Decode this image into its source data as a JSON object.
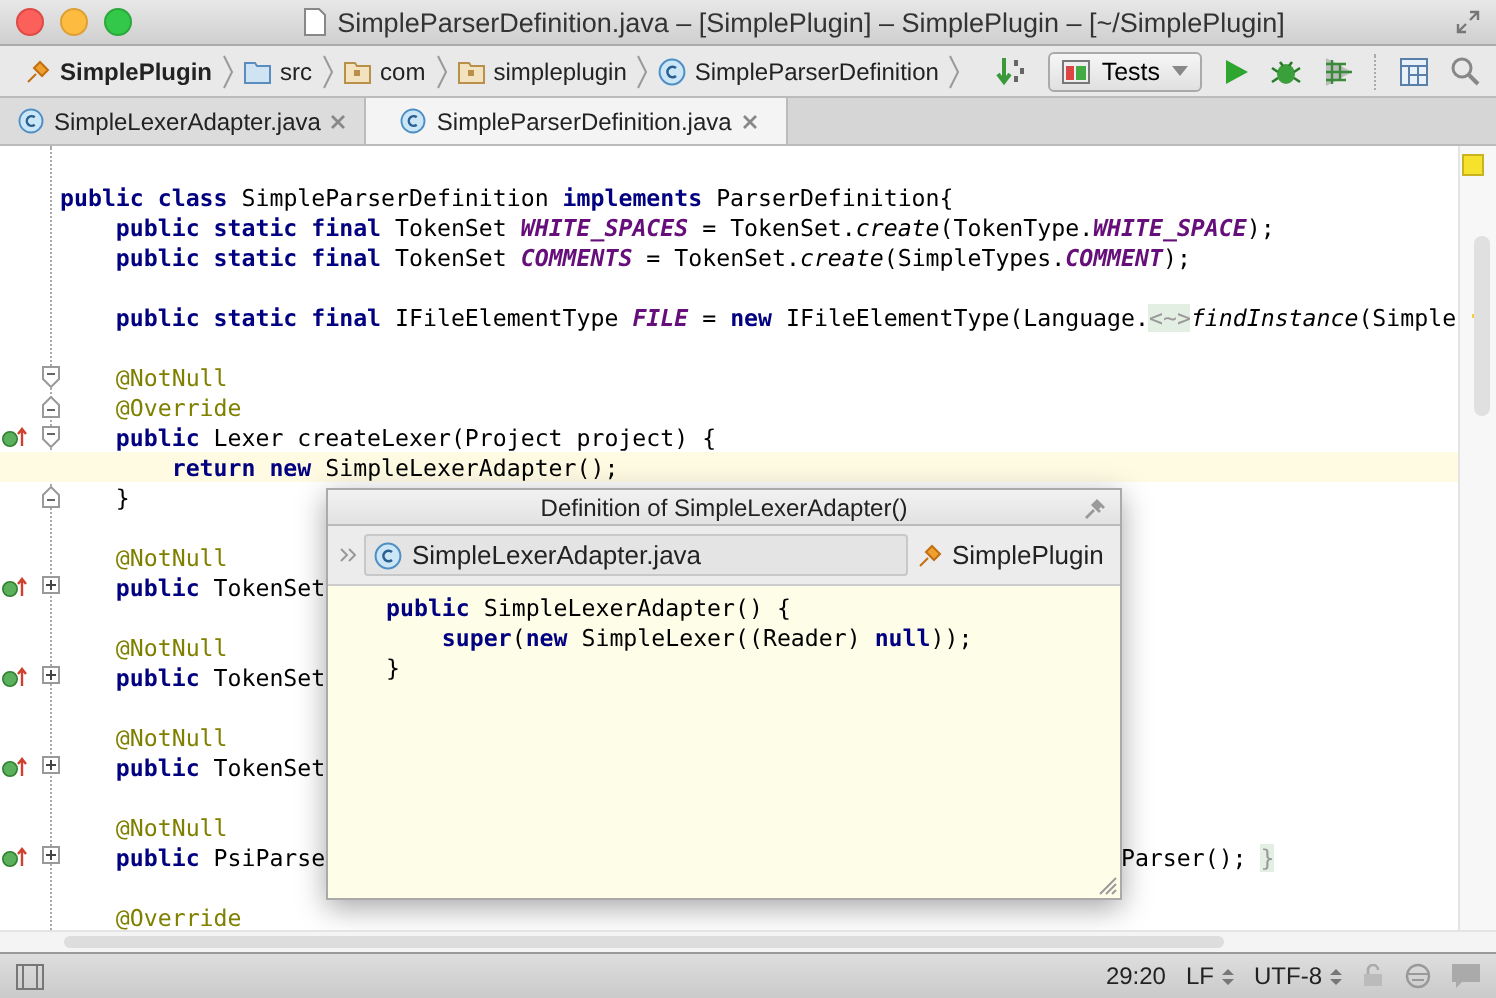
{
  "window": {
    "title": "SimpleParserDefinition.java – [SimplePlugin] – SimplePlugin – [~/SimplePlugin]"
  },
  "breadcrumbs": [
    {
      "label": "SimplePlugin",
      "kind": "project"
    },
    {
      "label": "src",
      "kind": "folder"
    },
    {
      "label": "com",
      "kind": "package"
    },
    {
      "label": "simpleplugin",
      "kind": "package"
    },
    {
      "label": "SimpleParserDefinition",
      "kind": "class"
    }
  ],
  "run_config": {
    "label": "Tests"
  },
  "tabs": [
    {
      "label": "SimpleLexerAdapter.java",
      "selected": false
    },
    {
      "label": "SimpleParserDefinition.java",
      "selected": true
    }
  ],
  "code_lines": [
    {
      "kind": "blank"
    },
    {
      "kind": "code",
      "tokens": [
        {
          "kind": "kw",
          "t": "public class "
        },
        {
          "kind": "plain",
          "t": "SimpleParserDefinition "
        },
        {
          "kind": "kw",
          "t": "implements "
        },
        {
          "kind": "plain",
          "t": "ParserDefinition{"
        }
      ]
    },
    {
      "kind": "code",
      "tokens": [
        {
          "kind": "kw",
          "t": "    public static final "
        },
        {
          "kind": "plain",
          "t": "TokenSet "
        },
        {
          "kind": "field",
          "t": "WHITE_SPACES"
        },
        {
          "kind": "plain",
          "t": " = TokenSet."
        },
        {
          "kind": "italic",
          "t": "create"
        },
        {
          "kind": "plain",
          "t": "(TokenType."
        },
        {
          "kind": "field",
          "t": "WHITE_SPACE"
        },
        {
          "kind": "plain",
          "t": ");"
        }
      ]
    },
    {
      "kind": "code",
      "tokens": [
        {
          "kind": "kw",
          "t": "    public static final "
        },
        {
          "kind": "plain",
          "t": "TokenSet "
        },
        {
          "kind": "field",
          "t": "COMMENTS"
        },
        {
          "kind": "plain",
          "t": " = TokenSet."
        },
        {
          "kind": "italic",
          "t": "create"
        },
        {
          "kind": "plain",
          "t": "(SimpleTypes."
        },
        {
          "kind": "field",
          "t": "COMMENT"
        },
        {
          "kind": "plain",
          "t": ");"
        }
      ]
    },
    {
      "kind": "blank"
    },
    {
      "kind": "code",
      "tokens": [
        {
          "kind": "kw",
          "t": "    public static final "
        },
        {
          "kind": "plain",
          "t": "IFileElementType "
        },
        {
          "kind": "field",
          "t": "FILE"
        },
        {
          "kind": "plain",
          "t": " = "
        },
        {
          "kind": "kw",
          "t": "new "
        },
        {
          "kind": "plain",
          "t": "IFileElementType(Language."
        },
        {
          "kind": "folded",
          "t": "<~>"
        },
        {
          "kind": "italic",
          "t": "findInstance"
        },
        {
          "kind": "plain",
          "t": "(Simple"
        }
      ]
    },
    {
      "kind": "blank"
    },
    {
      "kind": "code",
      "fold_marker": {
        "kind": "start"
      },
      "tokens": [
        {
          "kind": "annot",
          "t": "    @NotNull"
        }
      ]
    },
    {
      "kind": "code",
      "fold_marker": {
        "kind": "end"
      },
      "tokens": [
        {
          "kind": "annot",
          "t": "    @Override"
        }
      ]
    },
    {
      "kind": "code",
      "fold_marker": {
        "kind": "start"
      },
      "implements_marker": true,
      "tokens": [
        {
          "kind": "kw",
          "t": "    public "
        },
        {
          "kind": "plain",
          "t": "Lexer createLexer(Project project) {"
        }
      ]
    },
    {
      "kind": "code",
      "current": true,
      "tokens": [
        {
          "kind": "kw",
          "t": "        return new "
        },
        {
          "kind": "plain",
          "t": "SimpleLexerAdapter();"
        }
      ]
    },
    {
      "kind": "code",
      "fold_marker": {
        "kind": "end"
      },
      "tokens": [
        {
          "kind": "plain",
          "t": "    }"
        }
      ]
    },
    {
      "kind": "blank"
    },
    {
      "kind": "code",
      "tokens": [
        {
          "kind": "annot",
          "t": "    @NotNull"
        }
      ]
    },
    {
      "kind": "code",
      "fold_marker": {
        "kind": "collapsed"
      },
      "implements_marker": true,
      "tokens": [
        {
          "kind": "kw",
          "t": "    public "
        },
        {
          "kind": "plain",
          "t": "TokenSet"
        }
      ]
    },
    {
      "kind": "blank"
    },
    {
      "kind": "code",
      "tokens": [
        {
          "kind": "annot",
          "t": "    @NotNull"
        }
      ]
    },
    {
      "kind": "code",
      "fold_marker": {
        "kind": "collapsed"
      },
      "implements_marker": true,
      "tokens": [
        {
          "kind": "kw",
          "t": "    public "
        },
        {
          "kind": "plain",
          "t": "TokenSet"
        }
      ]
    },
    {
      "kind": "blank"
    },
    {
      "kind": "code",
      "tokens": [
        {
          "kind": "annot",
          "t": "    @NotNull"
        }
      ]
    },
    {
      "kind": "code",
      "fold_marker": {
        "kind": "collapsed"
      },
      "implements_marker": true,
      "tokens": [
        {
          "kind": "kw",
          "t": "    public "
        },
        {
          "kind": "plain",
          "t": "TokenSet"
        }
      ]
    },
    {
      "kind": "blank"
    },
    {
      "kind": "code",
      "tokens": [
        {
          "kind": "annot",
          "t": "    @NotNull"
        }
      ]
    },
    {
      "kind": "code",
      "fold_marker": {
        "kind": "collapsed"
      },
      "implements_marker": true,
      "tokens": [
        {
          "kind": "kw",
          "t": "    public "
        },
        {
          "kind": "plain",
          "t": "PsiParse"
        }
      ],
      "tail": [
        {
          "kind": "plain",
          "t": "Parser(); "
        },
        {
          "kind": "folded",
          "t": "}"
        }
      ]
    },
    {
      "kind": "blank"
    },
    {
      "kind": "code",
      "tokens": [
        {
          "kind": "annot",
          "t": "    @Override"
        }
      ]
    }
  ],
  "popup": {
    "title": "Definition of SimpleLexerAdapter()",
    "file": "SimpleLexerAdapter.java",
    "module": "SimplePlugin",
    "code_lines": [
      {
        "tokens": [
          {
            "kind": "kw",
            "t": "public "
          },
          {
            "kind": "plain",
            "t": "SimpleLexerAdapter() {"
          }
        ]
      },
      {
        "tokens": [
          {
            "kind": "kw",
            "t": "    super"
          },
          {
            "kind": "plain",
            "t": "("
          },
          {
            "kind": "kw",
            "t": "new "
          },
          {
            "kind": "plain",
            "t": "SimpleLexer((Reader) "
          },
          {
            "kind": "kw",
            "t": "null"
          },
          {
            "kind": "plain",
            "t": "));"
          }
        ]
      },
      {
        "tokens": [
          {
            "kind": "plain",
            "t": "}"
          }
        ]
      }
    ]
  },
  "status_bar": {
    "position": "29:20",
    "line_separator": "LF",
    "encoding": "UTF-8"
  }
}
